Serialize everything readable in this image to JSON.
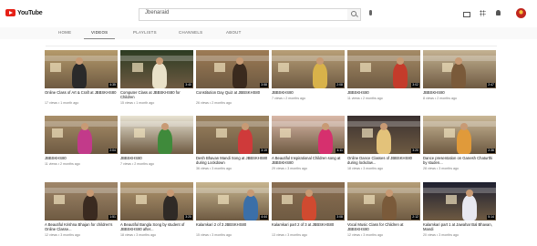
{
  "header": {
    "logo_text": "YouTube",
    "search_value": "Jbenaraid"
  },
  "tabs": [
    {
      "label": "HOME"
    },
    {
      "label": "VIDEOS"
    },
    {
      "label": "PLAYLISTS"
    },
    {
      "label": "CHANNELS"
    },
    {
      "label": "ABOUT"
    }
  ],
  "videos": [
    {
      "title": "Online Class of Art & Craft at JBBSKHS80",
      "meta": "17 views • 1 month ago",
      "duration": "4:35",
      "bg": "#b59a6b",
      "accent": "#2a2a2a"
    },
    {
      "title": "Computer Class at JBBSKHS80 for Children",
      "meta": "15 views • 1 month ago",
      "duration": "3:40",
      "bg": "#2c3b22",
      "accent": "#e9e1c8"
    },
    {
      "title": "Constitution Day Quiz at JBBSKHS80",
      "meta": "26 views • 2 months ago",
      "duration": "3:58",
      "bg": "#9d7b55",
      "accent": "#3a2a1e"
    },
    {
      "title": "JBBSKHS80",
      "meta": "7 views • 2 months ago",
      "duration": "2:08",
      "bg": "#b89f77",
      "accent": "#d8b24a"
    },
    {
      "title": "JBBSKHS80",
      "meta": "11 views • 2 months ago",
      "duration": "3:02",
      "bg": "#a58b66",
      "accent": "#c43b2b"
    },
    {
      "title": "JBBSKHS80",
      "meta": "8 views • 2 months ago",
      "duration": "2:47",
      "bg": "#c4b292",
      "accent": "#7a5a3a"
    },
    {
      "title": "JBBSKHS80",
      "meta": "11 views • 2 months ago",
      "duration": "2:04",
      "bg": "#a98f6a",
      "accent": "#c23a8a"
    },
    {
      "title": "JBBSKHS80",
      "meta": "7 views • 2 months ago",
      "duration": "",
      "bg": "#e8e3d2",
      "accent": "#3f8a3b"
    },
    {
      "title": "Desh Bhavan Mandi Song at JBBSKHS80 during Lockdown",
      "meta": "36 views • 3 months ago",
      "duration": "3:19",
      "bg": "#9c8360",
      "accent": "#cf3a3a"
    },
    {
      "title": "A Beautiful Inspirational Children song at JBBSKHS80",
      "meta": "29 views • 3 months ago",
      "duration": "4:11",
      "bg": "#d9b8a8",
      "accent": "#d6306e"
    },
    {
      "title": "Online Dance Classes of JBBSKHS80 during lockdow...",
      "meta": "18 views • 3 months ago",
      "duration": "3:20",
      "bg": "#3a3030",
      "accent": "#e3c27a"
    },
    {
      "title": "Dance presentation on Ganesh Chaturthi by studen...",
      "meta": "28 views • 3 months ago",
      "duration": "2:36",
      "bg": "#c9b796",
      "accent": "#e09a3a"
    },
    {
      "title": "A Beautiful Krishna Bhajan for children's Online Classe...",
      "meta": "12 views • 3 months ago",
      "duration": "1:51",
      "bg": "#a0876a",
      "accent": "#3a2a20"
    },
    {
      "title": "A Beautiful Bangla Song by student of JBBSKHS80 after...",
      "meta": "18 views • 3 months ago",
      "duration": "3:20",
      "bg": "#b2976f",
      "accent": "#2f2a26"
    },
    {
      "title": "Kalamkari 2 of 3 JBBSKHS80",
      "meta": "15 views • 3 months ago",
      "duration": "4:44",
      "bg": "#c7b58f",
      "accent": "#3b6fa8"
    },
    {
      "title": "Kalamkari part 2 of 3 at JBBSKHS80",
      "meta": "13 views • 3 months ago",
      "duration": "3:08",
      "bg": "#8b6f52",
      "accent": "#d04a30"
    },
    {
      "title": "Vocal Music Class for Children at JBBSKHS80",
      "meta": "12 views • 3 months ago",
      "duration": "2:12",
      "bg": "#b59e78",
      "accent": "#7a5a3a"
    },
    {
      "title": "Kalamkari part 1 at Jawahar Bal Bhavan, Mandi",
      "meta": "20 views • 3 months ago",
      "duration": "5:14",
      "bg": "#1e2030",
      "accent": "#e8e8f0"
    }
  ]
}
